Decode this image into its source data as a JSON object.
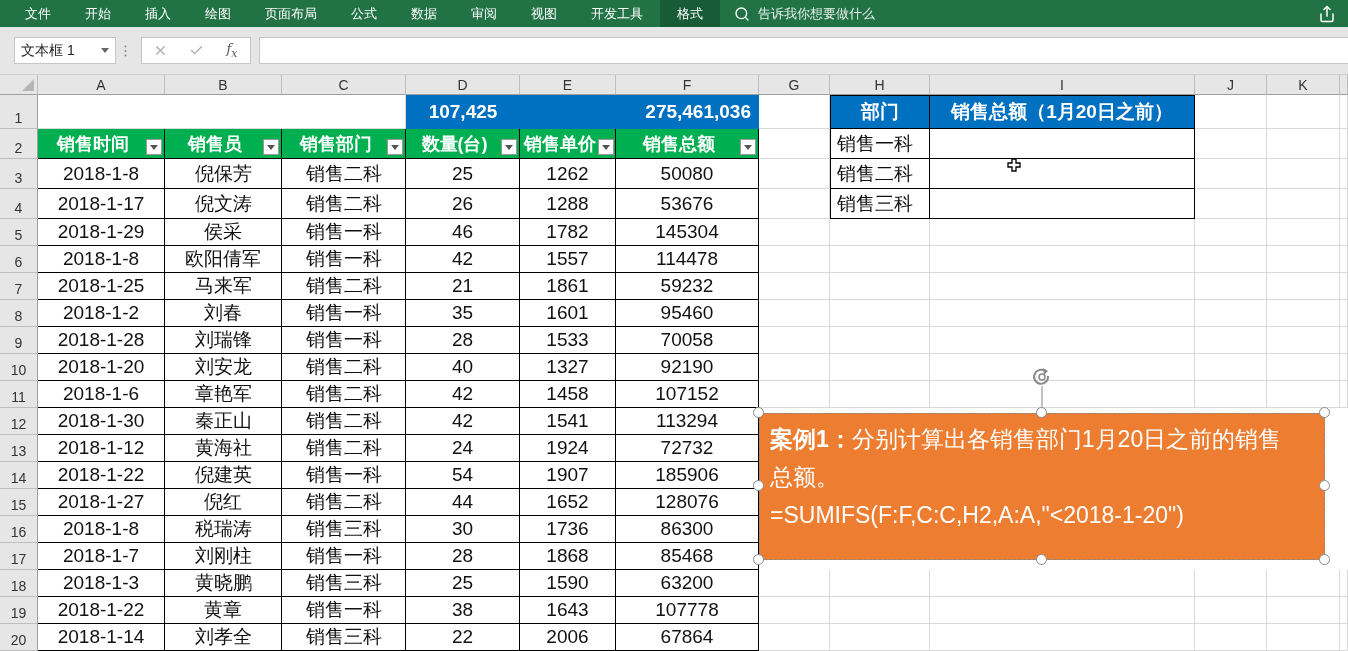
{
  "ribbon": {
    "tabs": [
      {
        "label": "文件",
        "selected": false
      },
      {
        "label": "开始",
        "selected": false
      },
      {
        "label": "插入",
        "selected": false
      },
      {
        "label": "绘图",
        "selected": false
      },
      {
        "label": "页面布局",
        "selected": false
      },
      {
        "label": "公式",
        "selected": false
      },
      {
        "label": "数据",
        "selected": false
      },
      {
        "label": "审阅",
        "selected": false
      },
      {
        "label": "视图",
        "selected": false
      },
      {
        "label": "开发工具",
        "selected": false
      },
      {
        "label": "格式",
        "selected": true
      }
    ],
    "search": {
      "placeholder": "告诉我你想要做什么"
    }
  },
  "formula_bar": {
    "name_box": "文本框 1",
    "fx": "f$_{x}$"
  },
  "columns": [
    "A",
    "B",
    "C",
    "D",
    "E",
    "F",
    "G",
    "H",
    "I",
    "J",
    "K"
  ],
  "row_numbers": [
    "1",
    "2",
    "3",
    "4",
    "5",
    "6",
    "7",
    "8",
    "9",
    "10",
    "11",
    "12",
    "13",
    "14",
    "15",
    "16",
    "17",
    "18",
    "19",
    "20"
  ],
  "sales_table": {
    "summary": {
      "quantity_total": "107,425",
      "amount_total": "275,461,036"
    },
    "headers": [
      {
        "label": "销售时间",
        "filter": true
      },
      {
        "label": "销售员",
        "filter": true
      },
      {
        "label": "销售部门",
        "filter": true
      },
      {
        "label": "数量(台)",
        "filter": true
      },
      {
        "label": "销售单价",
        "filter": true
      },
      {
        "label": "销售总额",
        "filter": true
      }
    ],
    "rows": [
      [
        "2018-1-8",
        "倪保芳",
        "销售二科",
        "25",
        "1262",
        "50080"
      ],
      [
        "2018-1-17",
        "倪文涛",
        "销售二科",
        "26",
        "1288",
        "53676"
      ],
      [
        "2018-1-29",
        "侯采",
        "销售一科",
        "46",
        "1782",
        "145304"
      ],
      [
        "2018-1-8",
        "欧阳倩军",
        "销售一科",
        "42",
        "1557",
        "114478"
      ],
      [
        "2018-1-25",
        "马来军",
        "销售二科",
        "21",
        "1861",
        "59232"
      ],
      [
        "2018-1-2",
        "刘春",
        "销售一科",
        "35",
        "1601",
        "95460"
      ],
      [
        "2018-1-28",
        "刘瑞锋",
        "销售一科",
        "28",
        "1533",
        "70058"
      ],
      [
        "2018-1-20",
        "刘安龙",
        "销售二科",
        "40",
        "1327",
        "92190"
      ],
      [
        "2018-1-6",
        "章艳军",
        "销售二科",
        "42",
        "1458",
        "107152"
      ],
      [
        "2018-1-30",
        "秦正山",
        "销售二科",
        "42",
        "1541",
        "113294"
      ],
      [
        "2018-1-12",
        "黄海社",
        "销售二科",
        "24",
        "1924",
        "72732"
      ],
      [
        "2018-1-22",
        "倪建英",
        "销售一科",
        "54",
        "1907",
        "185906"
      ],
      [
        "2018-1-27",
        "倪红",
        "销售二科",
        "44",
        "1652",
        "128076"
      ],
      [
        "2018-1-8",
        "税瑞涛",
        "销售三科",
        "30",
        "1736",
        "86300"
      ],
      [
        "2018-1-7",
        "刘刚柱",
        "销售一科",
        "28",
        "1868",
        "85468"
      ],
      [
        "2018-1-3",
        "黄晓鹏",
        "销售三科",
        "25",
        "1590",
        "63200"
      ],
      [
        "2018-1-22",
        "黄章",
        "销售一科",
        "38",
        "1643",
        "107778"
      ],
      [
        "2018-1-14",
        "刘孝全",
        "销售三科",
        "22",
        "2006",
        "67864"
      ]
    ]
  },
  "result_table": {
    "headers": [
      "部门",
      "销售总额（1月20日之前）"
    ],
    "rows": [
      "销售一科",
      "销售二科",
      "销售三科"
    ]
  },
  "text_box": {
    "task": "**案例1：**分别计算出各销售部门1月20日之前的销售总额。",
    "formula": "=SUMIFS(F:F,C:C,H2,A:A,\"<2018-1-20\")"
  }
}
